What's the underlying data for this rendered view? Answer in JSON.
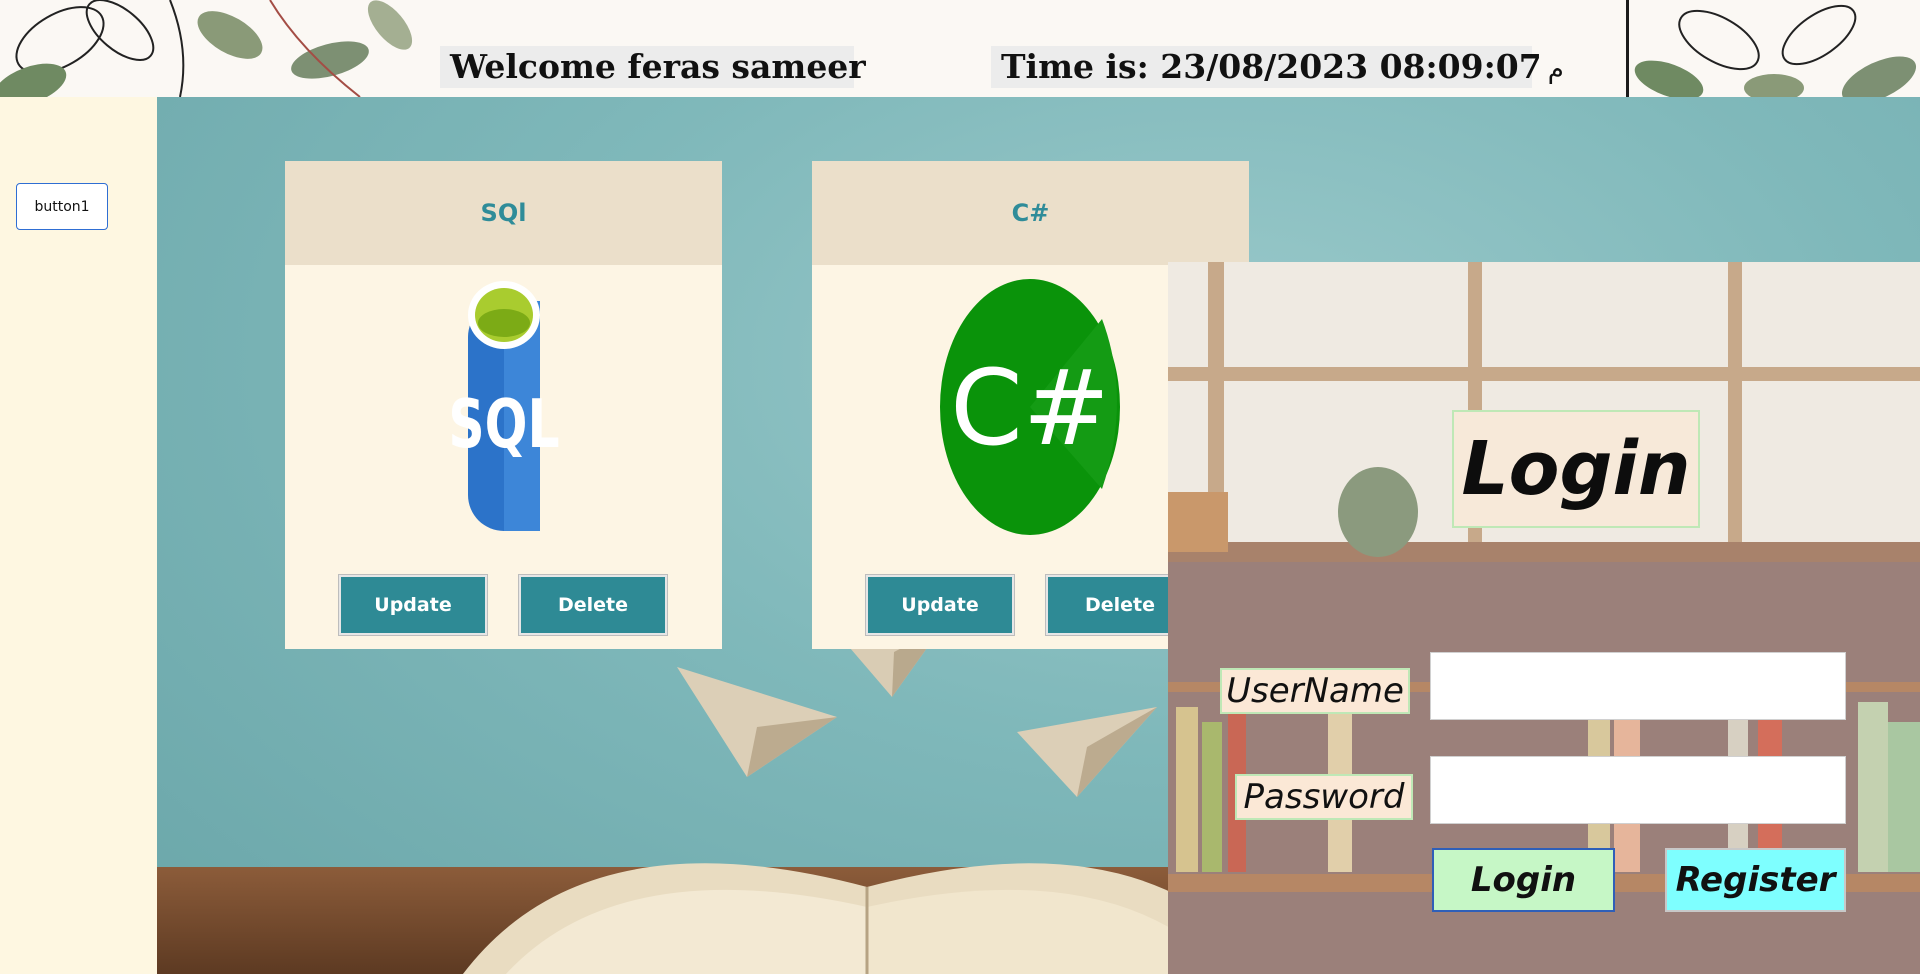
{
  "header": {
    "welcome_text": "Welcome feras sameer",
    "time_text": "Time is: 23/08/2023 08:09:07",
    "time_suffix": "م"
  },
  "sidebar": {
    "button1_label": "button1"
  },
  "cards": [
    {
      "caption": "SQl",
      "logo_icon": "sql-database-icon",
      "logo_text": "SQL",
      "update_label": "Update",
      "delete_label": "Delete"
    },
    {
      "caption": "C#",
      "logo_icon": "csharp-logo-icon",
      "logo_text": "C#",
      "update_label": "Update",
      "delete_label": "Delete"
    }
  ],
  "login": {
    "title": "Login",
    "username_label": "UserName",
    "password_label": "Password",
    "username_value": "",
    "password_value": "",
    "login_button": "Login",
    "register_button": "Register"
  },
  "colors": {
    "sidebar_bg": "#fef7e1",
    "card_caption": "#2f8c99",
    "card_button": "#2e8a95",
    "login_button": "#c6f7c6",
    "register_button": "#7effff"
  }
}
